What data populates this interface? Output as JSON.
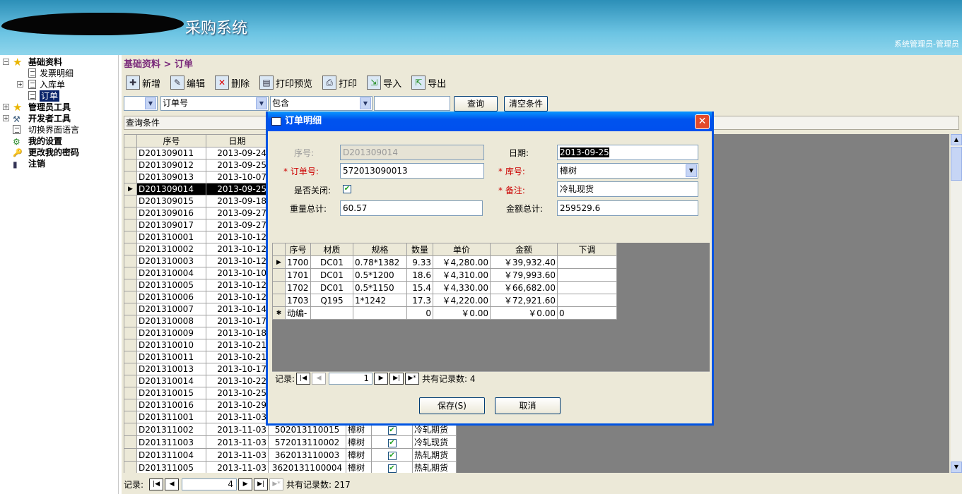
{
  "app": {
    "title": "采购系统",
    "user": "系统管理员-管理员"
  },
  "sidebar": {
    "items": [
      {
        "label": "基础资料",
        "icon": "star-icon",
        "bold": true,
        "expander": "−"
      },
      {
        "label": "发票明细",
        "icon": "document-icon"
      },
      {
        "label": "入库单",
        "icon": "document-icon",
        "expander": "+"
      },
      {
        "label": "订单",
        "icon": "document-icon",
        "selected": true
      },
      {
        "label": "管理员工具",
        "icon": "star-icon",
        "bold": true,
        "expander": "+"
      },
      {
        "label": "开发者工具",
        "icon": "tools-icon",
        "bold": true,
        "expander": "+"
      },
      {
        "label": "切换界面语言",
        "icon": "document-icon"
      },
      {
        "label": "我的设置",
        "icon": "settings-icon",
        "bold": true
      },
      {
        "label": "更改我的密码",
        "icon": "key-icon",
        "bold": true
      },
      {
        "label": "注销",
        "icon": "logout-icon",
        "bold": true
      }
    ]
  },
  "main": {
    "breadcrumb": "基础资料 > 订单",
    "toolbar": {
      "new": "新增",
      "edit": "编辑",
      "delete": "删除",
      "print_preview": "打印预览",
      "print": "打印",
      "import": "导入",
      "export": "导出"
    },
    "filter": {
      "field": "订单号",
      "operator": "包含",
      "value": "",
      "query": "查询",
      "clear": "清空条件"
    },
    "condition_label": "查询条件",
    "columns": [
      "序号",
      "日期"
    ],
    "rows": [
      [
        "D201309011",
        "2013-09-24"
      ],
      [
        "D201309012",
        "2013-09-25"
      ],
      [
        "D201309013",
        "2013-10-07"
      ],
      [
        "D201309014",
        "2013-09-25"
      ],
      [
        "D201309015",
        "2013-09-18"
      ],
      [
        "D201309016",
        "2013-09-27"
      ],
      [
        "D201309017",
        "2013-09-27"
      ],
      [
        "D201310001",
        "2013-10-12"
      ],
      [
        "D201310002",
        "2013-10-12"
      ],
      [
        "D201310003",
        "2013-10-12"
      ],
      [
        "D201310004",
        "2013-10-10"
      ],
      [
        "D201310005",
        "2013-10-12"
      ],
      [
        "D201310006",
        "2013-10-12"
      ],
      [
        "D201310007",
        "2013-10-14"
      ],
      [
        "D201310008",
        "2013-10-17"
      ],
      [
        "D201310009",
        "2013-10-18"
      ],
      [
        "D201310010",
        "2013-10-21"
      ],
      [
        "D201310011",
        "2013-10-21"
      ],
      [
        "D201310013",
        "2013-10-17"
      ],
      [
        "D201310014",
        "2013-10-22"
      ],
      [
        "D201310015",
        "2013-10-25"
      ],
      [
        "D201310016",
        "2013-10-29"
      ],
      [
        "D201311001",
        "2013-11-03"
      ]
    ],
    "selected_row": 3,
    "rows_full": [
      [
        "D201311002",
        "2013-11-03",
        "502013110015",
        "樟树",
        true,
        "冷轧期货"
      ],
      [
        "D201311003",
        "2013-11-03",
        "572013110002",
        "樟树",
        true,
        "冷轧现货"
      ],
      [
        "D201311004",
        "2013-11-03",
        "362013110003",
        "樟树",
        true,
        "热轧期货"
      ],
      [
        "D201311005",
        "2013-11-03",
        "3620131100004",
        "樟树",
        true,
        "热轧期货"
      ]
    ],
    "nav": {
      "label": "记录:",
      "current": "4",
      "total": "共有记录数: 217"
    }
  },
  "dialog": {
    "title": "订单明细",
    "fields": {
      "seq_label": "序号:",
      "seq_value": "D201309014",
      "date_label": "日期:",
      "date_value": "2013-09-25",
      "order_label": "订单号:",
      "order_value": "572013090013",
      "store_label": "库号:",
      "store_value": "樟树",
      "closed_label": "是否关闭:",
      "remark_label": "备注:",
      "remark_value": "冷轧现货",
      "weight_label": "重量总计:",
      "weight_value": "60.57",
      "amount_label": "金额总计:",
      "amount_value": "259529.6"
    },
    "columns": [
      "序号",
      "材质",
      "规格",
      "数量",
      "单价",
      "金额",
      "下调"
    ],
    "rows": [
      [
        "1700",
        "DC01",
        "0.78*1382",
        "9.33",
        "￥4,280.00",
        "￥39,932.40",
        ""
      ],
      [
        "1701",
        "DC01",
        "0.5*1200",
        "18.6",
        "￥4,310.00",
        "￥79,993.60",
        ""
      ],
      [
        "1702",
        "DC01",
        "0.5*1150",
        "15.4",
        "￥4,330.00",
        "￥66,682.00",
        ""
      ],
      [
        "1703",
        "Q195",
        "1*1242",
        "17.3",
        "￥4,220.00",
        "￥72,921.60",
        ""
      ],
      [
        "动编-",
        "",
        "",
        "0",
        "￥0.00",
        "￥0.00",
        "0"
      ]
    ],
    "nav": {
      "label": "记录:",
      "current": "1",
      "total": "共有记录数: 4"
    },
    "save": "保存(S)",
    "cancel": "取消"
  }
}
